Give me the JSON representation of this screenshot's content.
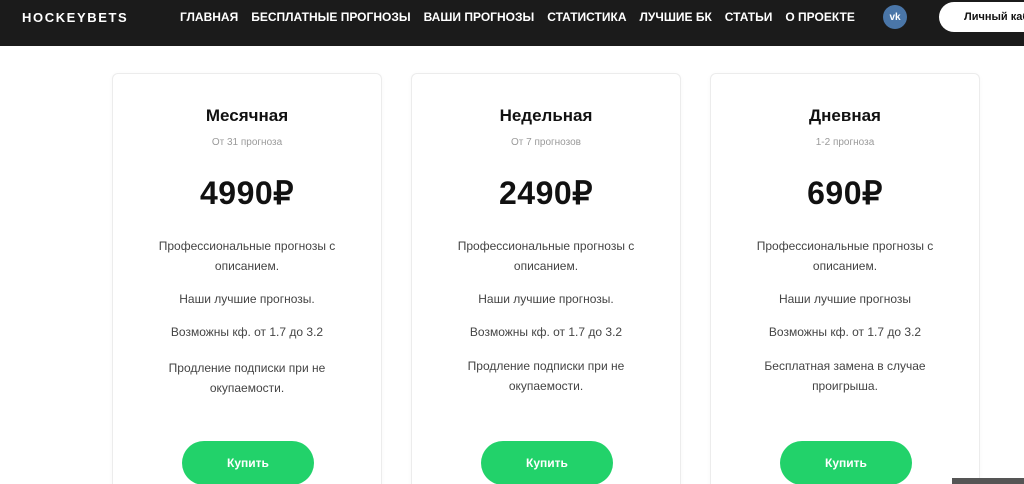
{
  "header": {
    "logo": "HOCKEYBETS",
    "nav": [
      "ГЛАВНАЯ",
      "БЕСПЛАТНЫЕ ПРОГНОЗЫ",
      "ВАШИ ПРОГНОЗЫ",
      "СТАТИСТИКА",
      "ЛУЧШИЕ БК",
      "СТАТЬИ",
      "О ПРОЕКТЕ"
    ],
    "vk_icon": "vk-icon",
    "vk_text": "vk",
    "cabinet": "Личный кабинет"
  },
  "plans": [
    {
      "title": "Месячная",
      "subtitle": "От 31 прогноза",
      "price": "4990₽",
      "features": [
        "Профессиональные прогнозы с описанием.",
        "Наши лучшие прогнозы.",
        "Возможны кф. от 1.7 до 3.2",
        "Продление подписки при не окупаемости."
      ],
      "button": "Купить"
    },
    {
      "title": "Недельная",
      "subtitle": "От 7 прогнозов",
      "price": "2490₽",
      "features": [
        "Профессиональные прогнозы с описанием.",
        "Наши лучшие прогнозы.",
        "Возможны кф. от 1.7 до 3.2",
        "Продление подписки при не окупаемости."
      ],
      "button": "Купить"
    },
    {
      "title": "Дневная",
      "subtitle": "1-2 прогноза",
      "price": "690₽",
      "features": [
        "Профессиональные прогнозы с описанием.",
        "Наши лучшие прогнозы",
        "Возможны кф. от 1.7 до 3.2",
        "Бесплатная замена в случае проигрыша."
      ],
      "button": "Купить"
    }
  ],
  "colors": {
    "topbar": "#1b1b1b",
    "accent": "#22d26a",
    "vk": "#4a76a8"
  }
}
